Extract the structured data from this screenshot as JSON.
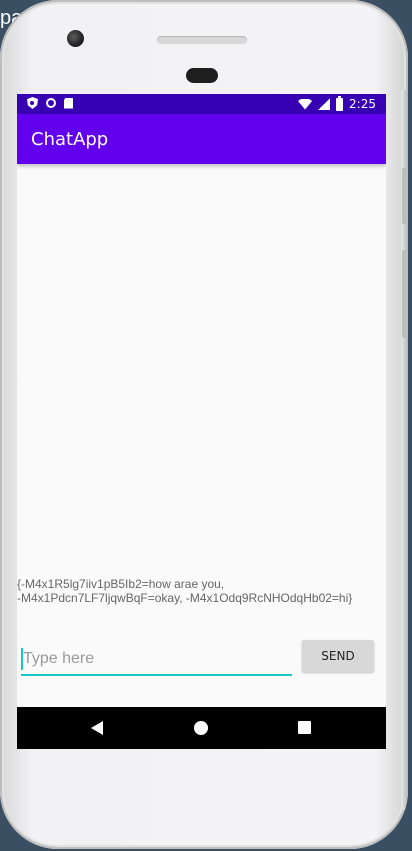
{
  "background": {
    "partial_text": "pa"
  },
  "device": {
    "status_bar": {
      "time": "2:25",
      "left_icons": [
        "shield-icon",
        "circle-icon",
        "sd-card-icon"
      ],
      "right_icons": [
        "wifi-icon",
        "signal-icon",
        "battery-icon"
      ]
    },
    "app_bar": {
      "title": "ChatApp"
    },
    "chat": {
      "message_text": "{-M4x1R5lg7iiv1pB5Ib2=how arae you,\n-M4x1Pdcn7LF7ljqwBqF=okay, -M4x1Odq9RcNHOdqHb02=hi}"
    },
    "composer": {
      "input_value": "",
      "input_placeholder": "Type here",
      "send_label": "SEND"
    },
    "navigation": {
      "buttons": [
        "back-icon",
        "home-icon",
        "recents-icon"
      ]
    }
  },
  "colors": {
    "status_bar": "#3700b3",
    "app_bar": "#6200ee",
    "accent": "#1cc7c7",
    "screen_background": "#fafafa",
    "nav_bar": "#000000"
  }
}
